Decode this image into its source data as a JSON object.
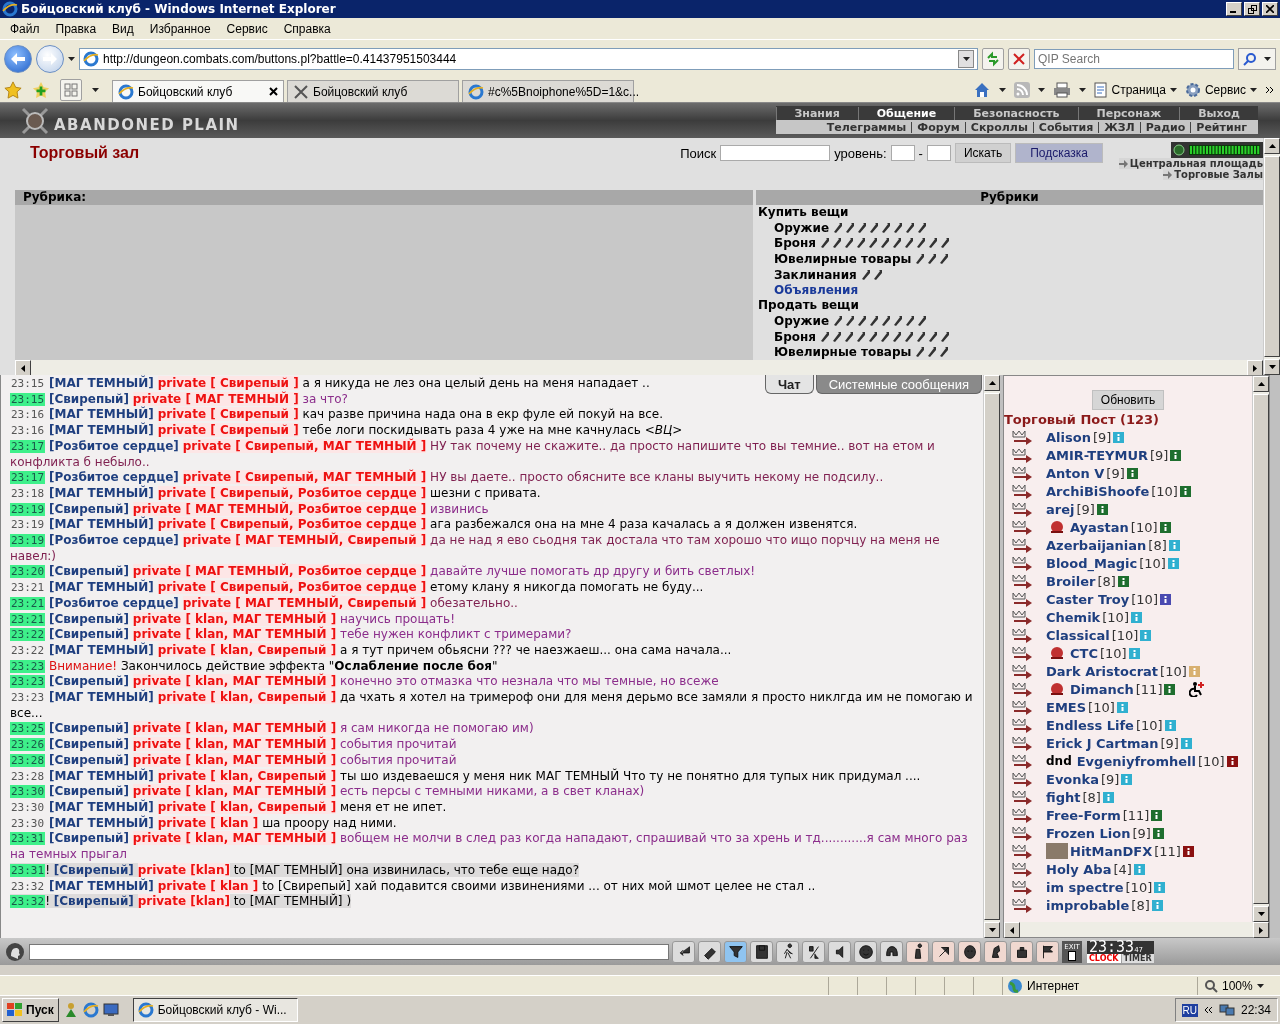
{
  "window": {
    "title": "Бойцовский клуб - Windows Internet Explorer"
  },
  "menu": [
    "Файл",
    "Правка",
    "Вид",
    "Избранное",
    "Сервис",
    "Справка"
  ],
  "address": {
    "url": "http://dungeon.combats.com/buttons.pl?battle=0.41437951503444"
  },
  "search": {
    "placeholder": "QIP Search"
  },
  "tabs": [
    {
      "label": "Бойцовский клуб",
      "selected": true,
      "kind": "ie"
    },
    {
      "label": "Бойцовский клуб",
      "selected": false,
      "kind": "swords"
    },
    {
      "label": "#c%5Bnoiphone%5D=1&c...",
      "selected": false,
      "kind": "ie"
    }
  ],
  "command_bar": [
    "Страница",
    "Сервис"
  ],
  "game_header": {
    "logo": "ABANDONED PLAIN",
    "nav": [
      {
        "label": "Знания",
        "selected": false
      },
      {
        "label": "Общение",
        "selected": true
      },
      {
        "label": "Безопасность",
        "selected": false
      },
      {
        "label": "Персонаж",
        "selected": false
      },
      {
        "label": "Выход",
        "selected": false
      }
    ],
    "subnav": [
      "Телеграммы",
      "Форум",
      "Скроллы",
      "События",
      "ЖЗЛ",
      "Радио",
      "Рейтинг"
    ]
  },
  "page": {
    "title": "Торговый зал",
    "search_label": "Поиск",
    "level_label": "уровень:",
    "dash": "-",
    "search_button": "Искать",
    "hint_button": "Подсказка",
    "links": [
      "Центральная площадь",
      "Торговые Залы"
    ]
  },
  "rubrics": {
    "header_left": "Рубрика:",
    "header_right": "Рубрики",
    "sections": [
      {
        "label": "Купить вещи",
        "children": [
          {
            "label": "Оружие",
            "kind": "category"
          },
          {
            "label": "Броня",
            "kind": "category"
          },
          {
            "label": "Ювелирные товары",
            "kind": "category"
          },
          {
            "label": "Заклинания",
            "kind": "category"
          },
          {
            "label": "Объявления",
            "kind": "link"
          }
        ]
      },
      {
        "label": "Продать вещи",
        "children": [
          {
            "label": "Оружие",
            "kind": "category"
          },
          {
            "label": "Броня",
            "kind": "category"
          },
          {
            "label": "Ювелирные товары",
            "kind": "category"
          }
        ]
      }
    ]
  },
  "chat": {
    "tabs": [
      {
        "label": "Чат",
        "selected": true
      },
      {
        "label": "Системные сообщения",
        "selected": false
      }
    ],
    "messages": [
      {
        "kind": "private",
        "time": "23:15",
        "highlighted": false,
        "sender": "[МАГ ТЕМНЫЙ]",
        "private": "private [ Свирепый ]",
        "text": "а я никуда не лез она целый день на меня нападает ..",
        "color": "#000000"
      },
      {
        "kind": "private",
        "time": "23:15",
        "highlighted": true,
        "sender": "[Свирепый]",
        "private": "private [ МАГ ТЕМНЫЙ ]",
        "text": "за что?",
        "color": "#8b2d8b"
      },
      {
        "kind": "private",
        "time": "23:16",
        "highlighted": false,
        "sender": "[МАГ ТЕМНЫЙ]",
        "private": "private [ Свирепый ]",
        "text": "кач разве причина нада она в екр фуле ей покуй на все.",
        "color": "#000000"
      },
      {
        "kind": "private",
        "time": "23:16",
        "highlighted": false,
        "sender": "[МАГ ТЕМНЫЙ]",
        "private": "private [ Свирепый ]",
        "text": "тебе логи поскидывать раза 4 уже на мне качнулась *<ВЦ>*",
        "color": "#000000"
      },
      {
        "kind": "private",
        "time": "23:17",
        "highlighted": true,
        "sender": "[Розбитое сердце]",
        "private": "private [ Свирепый, МАГ ТЕМНЫЙ ]",
        "text": "НУ так почему не скажите.. да просто напишите что вы темние.. вот на етом и конфликта б небыло..",
        "color": "#7f1f4f"
      },
      {
        "kind": "private",
        "time": "23:17",
        "highlighted": true,
        "sender": "[Розбитое сердце]",
        "private": "private [ Свирепый, МАГ ТЕМНЫЙ ]",
        "text": "НУ вы даете.. просто обясните все кланы выучить некому не подсилу..",
        "color": "#7f1f4f"
      },
      {
        "kind": "private",
        "time": "23:18",
        "highlighted": false,
        "sender": "[МАГ ТЕМНЫЙ]",
        "private": "private [ Свирепый, Розбитое сердце ]",
        "text": "шезни с привата.",
        "color": "#000000"
      },
      {
        "kind": "private",
        "time": "23:19",
        "highlighted": true,
        "sender": "[Свирепый]",
        "private": "private [ МАГ ТЕМНЫЙ, Розбитое сердце ]",
        "text": "извинись",
        "color": "#8b2d8b"
      },
      {
        "kind": "private",
        "time": "23:19",
        "highlighted": false,
        "sender": "[МАГ ТЕМНЫЙ]",
        "private": "private [ Свирепый, Розбитое сердце ]",
        "text": "ага разбежался она на мне 4 раза качалась а я должен извенятся.",
        "color": "#000000"
      },
      {
        "kind": "private",
        "time": "23:19",
        "highlighted": true,
        "sender": "[Розбитое сердце]",
        "private": "private [ МАГ ТЕМНЫЙ, Свирепый ]",
        "text": "да не над я ево сьодня так достала что там хорошо что ищо порчцу на меня не навел:)",
        "color": "#7f1f4f"
      },
      {
        "kind": "private",
        "time": "23:20",
        "highlighted": true,
        "sender": "[Свирепый]",
        "private": "private [ МАГ ТЕМНЫЙ, Розбитое сердце ]",
        "text": "давайте лучше помогать др другу и бить светлых!",
        "color": "#8b2d8b"
      },
      {
        "kind": "private",
        "time": "23:21",
        "highlighted": false,
        "sender": "[МАГ ТЕМНЫЙ]",
        "private": "private [ Свирепый, Розбитое сердце ]",
        "text": "етому клану я никогда помогать не буду...",
        "color": "#000000"
      },
      {
        "kind": "private",
        "time": "23:21",
        "highlighted": true,
        "sender": "[Розбитое сердце]",
        "private": "private [ МАГ ТЕМНЫЙ, Свирепый ]",
        "text": "обезательно..",
        "color": "#7f1f4f"
      },
      {
        "kind": "private",
        "time": "23:21",
        "highlighted": true,
        "sender": "[Свирепый]",
        "private": "private [ klan, МАГ ТЕМНЫЙ ]",
        "text": "научись прощать!",
        "color": "#8b2d8b"
      },
      {
        "kind": "private",
        "time": "23:22",
        "highlighted": true,
        "sender": "[Свирепый]",
        "private": "private [ klan, МАГ ТЕМНЫЙ ]",
        "text": "тебе нужен конфликт с тримерами?",
        "color": "#8b2d8b"
      },
      {
        "kind": "private",
        "time": "23:22",
        "highlighted": false,
        "sender": "[МАГ ТЕМНЫЙ]",
        "private": "private [ klan, Свирепый ]",
        "text": "а я тут причем обьясни ??? че наезжаеш... она сама начала...",
        "color": "#000000"
      },
      {
        "kind": "system",
        "time": "23:23",
        "highlighted": true,
        "label": "Внимание!",
        "text": "Закончилось действие эффекта \"**Ослабление после боя**\""
      },
      {
        "kind": "private",
        "time": "23:23",
        "highlighted": true,
        "sender": "[Свирепый]",
        "private": "private [ klan, МАГ ТЕМНЫЙ ]",
        "text": "конечно это отмазка что незнала что мы темные, но всеже",
        "color": "#8b2d8b"
      },
      {
        "kind": "private",
        "time": "23:23",
        "highlighted": false,
        "sender": "[МАГ ТЕМНЫЙ]",
        "private": "private [ klan, Свирепый ]",
        "text": "да чхать я хотел на тримероф они для меня дерьмо все замяли я просто никлгда им не помогаю и все...",
        "color": "#000000"
      },
      {
        "kind": "private",
        "time": "23:25",
        "highlighted": true,
        "sender": "[Свирепый]",
        "private": "private [ klan, МАГ ТЕМНЫЙ ]",
        "text": "я сам никогда не помогаю им)",
        "color": "#8b2d8b"
      },
      {
        "kind": "private",
        "time": "23:26",
        "highlighted": true,
        "sender": "[Свирепый]",
        "private": "private [ klan, МАГ ТЕМНЫЙ ]",
        "text": "события прочитай",
        "color": "#8b2d8b"
      },
      {
        "kind": "private",
        "time": "23:28",
        "highlighted": true,
        "sender": "[Свирепый]",
        "private": "private [ klan, МАГ ТЕМНЫЙ ]",
        "text": "события прочитай",
        "color": "#8b2d8b"
      },
      {
        "kind": "private",
        "time": "23:28",
        "highlighted": false,
        "sender": "[МАГ ТЕМНЫЙ]",
        "private": "private [ klan, Свирепый ]",
        "text": "ты шо издеваешся у меня ник МАГ ТЕМНЫЙ Что ту не понятно для тупых ник придумал ....",
        "color": "#000000"
      },
      {
        "kind": "private",
        "time": "23:30",
        "highlighted": true,
        "sender": "[Свирепый]",
        "private": "private [ klan, МАГ ТЕМНЫЙ ]",
        "text": "есть персы с темными никами, а в свет кланах)",
        "color": "#8b2d8b"
      },
      {
        "kind": "private",
        "time": "23:30",
        "highlighted": false,
        "sender": "[МАГ ТЕМНЫЙ]",
        "private": "private [ klan, Свирепый ]",
        "text": "меня ет не ипет.",
        "color": "#000000"
      },
      {
        "kind": "private",
        "time": "23:30",
        "highlighted": false,
        "sender": "[МАГ ТЕМНЫЙ]",
        "private": "private [ klan ]",
        "text": "ша проору над ними.",
        "color": "#000000"
      },
      {
        "kind": "private",
        "time": "23:31",
        "highlighted": true,
        "sender": "[Свирепый]",
        "private": "private [ klan, МАГ ТЕМНЫЙ ]",
        "text": "вобщем не молчи в след раз когда нападают, спрашивай что за хрень и тд............я сам много раз на темных прыгал",
        "color": "#8b2d8b"
      },
      {
        "kind": "private",
        "time": "23:31",
        "highlighted": true,
        "mark": "!",
        "sender": "[Свирепый]",
        "private": "private [klan]",
        "to": "to [МАГ ТЕМНЫЙ]",
        "text": "она извинилась, что тебе еще надо?",
        "color": "#000000"
      },
      {
        "kind": "private",
        "time": "23:32",
        "highlighted": false,
        "sender": "[МАГ ТЕМНЫЙ]",
        "private": "private [ klan ]",
        "to": "to [Свирепый]",
        "text": "хай подавится своими извинениями ... от них мой шмот целее не стал ..",
        "color": "#000000"
      },
      {
        "kind": "private",
        "time": "23:32",
        "highlighted": true,
        "mark": "!",
        "sender": "[Свирепый]",
        "private": "private [klan]",
        "to": "to [МАГ ТЕМНЫЙ]",
        "text": ")",
        "color": "#000000"
      }
    ]
  },
  "online": {
    "refresh": "Обновить",
    "title": "Торговый Пост (123)",
    "users": [
      {
        "name": "Alison",
        "level": "[9]",
        "color": "#30b0d0",
        "kind": "plain",
        "status_icon": false
      },
      {
        "name": "AMIR-TEYMUR",
        "level": "[9]",
        "color": "#1e6e2e",
        "kind": "plain",
        "status_icon": false
      },
      {
        "name": "Anton V",
        "level": "[9]",
        "color": "#1e6e2e",
        "kind": "plain",
        "status_icon": false
      },
      {
        "name": "ArchiBiShoofe",
        "level": "[10]",
        "color": "#1e6e2e",
        "kind": "plain",
        "status_icon": false
      },
      {
        "name": "arej",
        "level": "[9]",
        "color": "#1e6e2e",
        "kind": "plain",
        "status_icon": false
      },
      {
        "name": "Ayastan",
        "level": "[10]",
        "color": "#1e6e2e",
        "kind": "clan",
        "status_icon": false
      },
      {
        "name": "Azerbaijanian",
        "level": "[8]",
        "color": "#30b0d0",
        "kind": "plain",
        "status_icon": false
      },
      {
        "name": "Blood_Magic",
        "level": "[10]",
        "color": "#30b0d0",
        "kind": "plain",
        "status_icon": false
      },
      {
        "name": "Broiler",
        "level": "[8]",
        "color": "#1e6e2e",
        "kind": "plain",
        "status_icon": false
      },
      {
        "name": "Caster Troy",
        "level": "[10]",
        "color": "#4a4ab0",
        "kind": "plain",
        "status_icon": false
      },
      {
        "name": "Chemik",
        "level": "[10]",
        "color": "#30b0d0",
        "kind": "plain",
        "status_icon": false
      },
      {
        "name": "Classical",
        "level": "[10]",
        "color": "#30b0d0",
        "kind": "plain",
        "status_icon": false
      },
      {
        "name": "CTC",
        "level": "[10]",
        "color": "#30b0d0",
        "kind": "clan",
        "status_icon": false
      },
      {
        "name": "Dark Aristocrat",
        "level": "[10]",
        "color": "#d8b070",
        "kind": "plain",
        "status_icon": false
      },
      {
        "name": "Dimanch",
        "level": "[11]",
        "color": "#1e6e2e",
        "kind": "clan",
        "status_icon": true
      },
      {
        "name": "EMES",
        "level": "[10]",
        "color": "#30b0d0",
        "kind": "plain",
        "status_icon": false
      },
      {
        "name": "Endless Life",
        "level": "[10]",
        "color": "#30b0d0",
        "kind": "plain",
        "status_icon": false
      },
      {
        "name": "Erick J Cartman",
        "level": "[9]",
        "color": "#30b0d0",
        "kind": "plain",
        "status_icon": false
      },
      {
        "prefix": "dnd",
        "name": "Evgeniyfromhell",
        "level": "[10]",
        "color": "#8b1010",
        "kind": "plain",
        "status_icon": false
      },
      {
        "name": "Evonka",
        "level": "[9]",
        "color": "#30b0d0",
        "kind": "plain",
        "status_icon": false
      },
      {
        "name": "fight",
        "level": "[8]",
        "color": "#30b0d0",
        "kind": "plain",
        "status_icon": false
      },
      {
        "name": "Free-Form",
        "level": "[11]",
        "color": "#1e6e2e",
        "kind": "plain",
        "status_icon": false
      },
      {
        "name": "Frozen Lion",
        "level": "[9]",
        "color": "#1e6e2e",
        "kind": "plain",
        "status_icon": false
      },
      {
        "name": "HitManDFX",
        "level": "[11]",
        "color": "#8b1010",
        "kind": "portrait",
        "status_icon": false
      },
      {
        "name": "Holy Aba",
        "level": "[4]",
        "color": "#30b0d0",
        "kind": "plain",
        "status_icon": false
      },
      {
        "name": "im spectre",
        "level": "[10]",
        "color": "#30b0d0",
        "kind": "plain",
        "status_icon": false
      },
      {
        "name": "improbable",
        "level": "[8]",
        "color": "#30b0d0",
        "kind": "plain",
        "status_icon": false
      }
    ]
  },
  "toolbar": {
    "exit": "EXIT",
    "clock": "23:33",
    "seconds": "47",
    "clock_label": "CLOCK",
    "timer_label": "TIMER"
  },
  "status_bar": {
    "zone": "Интернет",
    "zoom": "100%"
  },
  "taskbar": {
    "start": "Пуск",
    "task": "Бойцовский клуб - Wi...",
    "lang": "RU",
    "time": "22:34"
  }
}
